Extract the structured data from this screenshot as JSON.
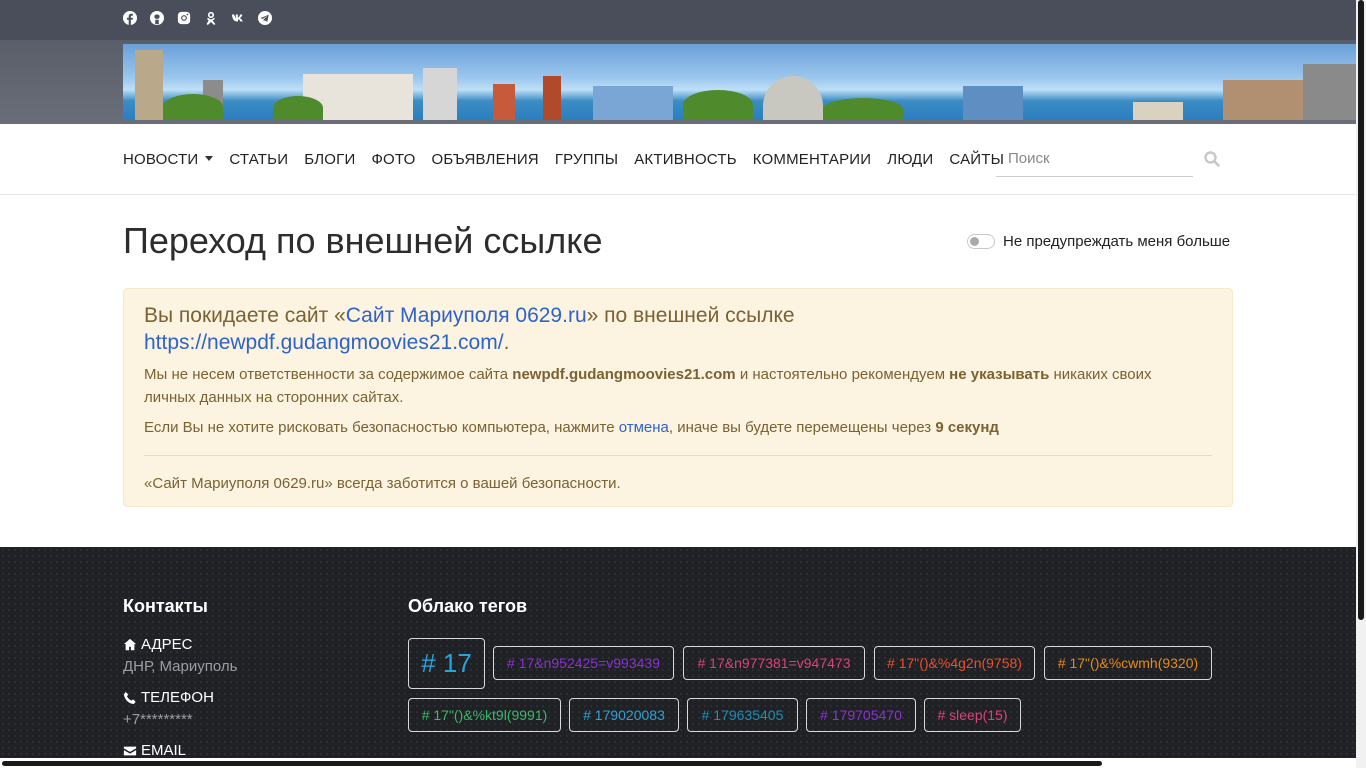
{
  "social": [
    "facebook-icon",
    "github-icon",
    "instagram-icon",
    "odnoklassniki-icon",
    "vk-icon",
    "telegram-icon"
  ],
  "nav": {
    "items": [
      "НОВОСТИ",
      "СТАТЬИ",
      "БЛОГИ",
      "ФОТО",
      "ОБЪЯВЛЕНИЯ",
      "ГРУППЫ",
      "АКТИВНОСТЬ",
      "КОММЕНТАРИИ",
      "ЛЮДИ",
      "САЙТЫ"
    ],
    "search_placeholder": "Поиск"
  },
  "main": {
    "title": "Переход по внешней ссылке",
    "toggle_label": "Не предупреждать меня больше",
    "alert": {
      "heading_prefix": "Вы покидаете сайт «",
      "site_name": "Сайт Мариуполя 0629.ru",
      "heading_mid": "» по внешней ссылке",
      "url": "https://newpdf.gudangmoovies21.com/",
      "heading_end": ".",
      "p1_a": "Мы не несем ответственности за содержимое сайта ",
      "p1_domain": "newpdf.gudangmoovies21.com",
      "p1_b": " и настоятельно рекомендуем ",
      "p1_bold": "не указывать",
      "p1_c": " никаких своих личных данных на сторонних сайтах.",
      "p2_a": "Если Вы не хотите рисковать безопасностью компьютера, нажмите ",
      "p2_link": "отмена",
      "p2_b": ", иначе вы будете перемещены через ",
      "p2_bold": "9 секунд",
      "p3": "«Сайт Мариуполя 0629.ru» всегда заботится о вашей безопасности."
    }
  },
  "footer": {
    "contacts_title": "Контакты",
    "address_label": "АДРЕС",
    "address_value": "ДНР, Мариуполь",
    "phone_label": "ТЕЛЕФОН",
    "phone_value": "+7*********",
    "email_label": "EMAIL",
    "tags_title": "Облако тегов",
    "tags": [
      {
        "text": "# 17",
        "color": "#2aa3d9"
      },
      {
        "text": "# 17&n952425=v993439",
        "color": "#8b2fd6"
      },
      {
        "text": "# 17&n977381=v947473",
        "color": "#e0407a"
      },
      {
        "text": "# 17\"()&%4g2n(9758)",
        "color": "#e8502a"
      },
      {
        "text": "# 17\"()&%cwmh(9320)",
        "color": "#e8891a"
      },
      {
        "text": "# 17\"()&%kt9l(9991)",
        "color": "#3cb96a"
      },
      {
        "text": "# 179020083",
        "color": "#2aa3d9"
      },
      {
        "text": "# 179635405",
        "color": "#1c8fb5"
      },
      {
        "text": "# 179705470",
        "color": "#8b2fd6"
      },
      {
        "text": "# sleep(15)",
        "color": "#e0407a"
      }
    ]
  }
}
